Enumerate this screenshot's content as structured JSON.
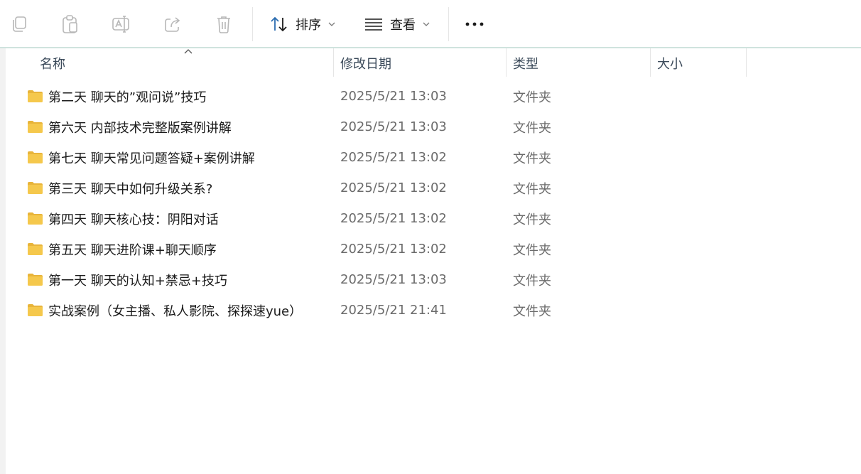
{
  "toolbar": {
    "icons": [
      "copy-icon",
      "paste-icon",
      "rename-icon",
      "share-icon",
      "delete-icon"
    ],
    "sort_label": "排序",
    "view_label": "查看"
  },
  "header": {
    "col_name": "名称",
    "col_date": "修改日期",
    "col_type": "类型",
    "col_size": "大小"
  },
  "files": [
    {
      "name": "第二天 聊天的”观问说”技巧",
      "date": "2025/5/21 13:03",
      "type": "文件夹"
    },
    {
      "name": "第六天 内部技术完整版案例讲解",
      "date": "2025/5/21 13:03",
      "type": "文件夹"
    },
    {
      "name": "第七天 聊天常见问题答疑+案例讲解",
      "date": "2025/5/21 13:02",
      "type": "文件夹"
    },
    {
      "name": "第三天 聊天中如何升级关系?",
      "date": "2025/5/21 13:02",
      "type": "文件夹"
    },
    {
      "name": "第四天 聊天核心技：阴阳对话",
      "date": "2025/5/21 13:02",
      "type": "文件夹"
    },
    {
      "name": "第五天 聊天进阶课+聊天顺序",
      "date": "2025/5/21 13:02",
      "type": "文件夹"
    },
    {
      "name": "第一天 聊天的认知+禁忌+技巧",
      "date": "2025/5/21 13:03",
      "type": "文件夹"
    },
    {
      "name": "实战案例（女主播、私人影院、探探速yue）",
      "date": "2025/5/21 21:41",
      "type": "文件夹"
    }
  ],
  "colors": {
    "folder_fill": "#f5c84c",
    "folder_back": "#e8b43a",
    "toolbar_border": "#cfe3de",
    "icon_gray": "#b7b7b7",
    "accent_blue": "#2b6cb0"
  }
}
